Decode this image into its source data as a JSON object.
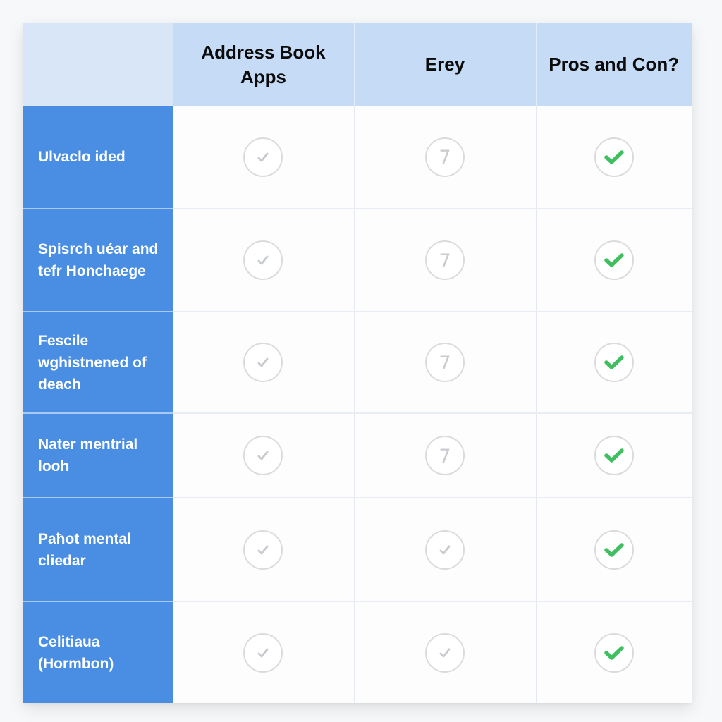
{
  "table": {
    "corner_label": "",
    "columns": [
      "Address Book Apps",
      "Erey",
      "Pros and Con?"
    ],
    "rows": [
      {
        "label": "Ulvaclo ided",
        "cells": [
          {
            "icon": "check-faded-icon",
            "glyph": "✓"
          },
          {
            "icon": "seven-faded-icon",
            "glyph": "7"
          },
          {
            "icon": "check-green-icon",
            "glyph": "✓"
          }
        ]
      },
      {
        "label": "Spisrch uéar and tefr Honchaege",
        "cells": [
          {
            "icon": "check-faded-icon",
            "glyph": "✓"
          },
          {
            "icon": "seven-faded-icon",
            "glyph": "7"
          },
          {
            "icon": "check-green-icon",
            "glyph": "✓"
          }
        ]
      },
      {
        "label": "Fescile wghistnened of deach",
        "cells": [
          {
            "icon": "check-faded-icon",
            "glyph": "✓"
          },
          {
            "icon": "seven-faded-icon",
            "glyph": "7"
          },
          {
            "icon": "check-green-icon",
            "glyph": "✓"
          }
        ]
      },
      {
        "label": "Nater mentrial looh",
        "cells": [
          {
            "icon": "check-faded-icon",
            "glyph": "✓"
          },
          {
            "icon": "seven-faded-icon",
            "glyph": "7"
          },
          {
            "icon": "check-green-icon",
            "glyph": "✓"
          }
        ]
      },
      {
        "label": "Paħot mental cliedar",
        "cells": [
          {
            "icon": "check-faded-icon",
            "glyph": "✓"
          },
          {
            "icon": "check-faded-icon",
            "glyph": "✓"
          },
          {
            "icon": "check-green-icon",
            "glyph": "✓"
          }
        ]
      },
      {
        "label": "Celitiaua (Hormbon)",
        "cells": [
          {
            "icon": "check-faded-icon",
            "glyph": "✓"
          },
          {
            "icon": "check-faded-icon",
            "glyph": "✓"
          },
          {
            "icon": "check-green-icon",
            "glyph": "✓"
          }
        ]
      }
    ]
  },
  "colors": {
    "row_label_bg": "#4a8ee3",
    "header_bg": "#c6dbf5",
    "corner_bg": "#d8e6f8",
    "check_green": "#3fbf5f",
    "faded_gray": "#c8cbd0",
    "circle_border": "#d9dbde"
  }
}
